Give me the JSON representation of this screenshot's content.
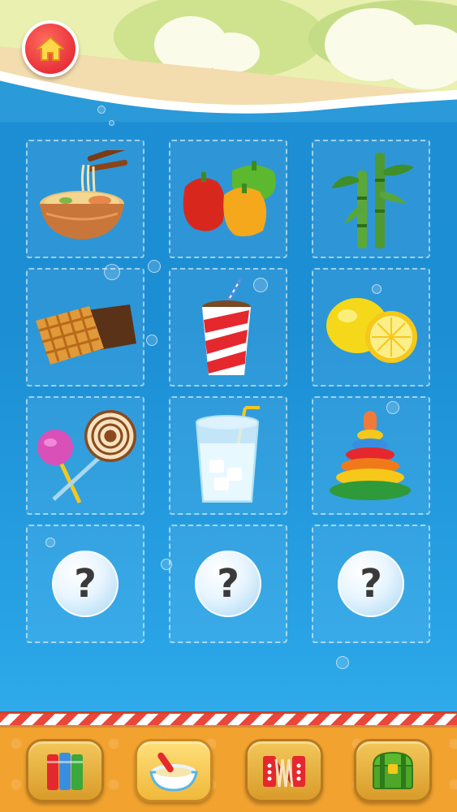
{
  "header": {
    "home_button": "home-icon"
  },
  "grid": {
    "items": [
      {
        "name": "noodle-bowl",
        "icon": "noodle-bowl-icon",
        "unlocked": true
      },
      {
        "name": "bell-peppers",
        "icon": "bell-peppers-icon",
        "unlocked": true
      },
      {
        "name": "bamboo",
        "icon": "bamboo-icon",
        "unlocked": true
      },
      {
        "name": "waffle",
        "icon": "waffle-icon",
        "unlocked": true
      },
      {
        "name": "soda-cup",
        "icon": "soda-cup-icon",
        "unlocked": true
      },
      {
        "name": "lemon",
        "icon": "lemon-icon",
        "unlocked": true
      },
      {
        "name": "lollipops",
        "icon": "lollipop-icon",
        "unlocked": true
      },
      {
        "name": "water-glass",
        "icon": "water-glass-icon",
        "unlocked": true
      },
      {
        "name": "stacking-rings",
        "icon": "ring-stack-icon",
        "unlocked": true
      },
      {
        "name": "locked",
        "icon": "question-bubble-icon",
        "unlocked": false,
        "label": "?"
      },
      {
        "name": "locked",
        "icon": "question-bubble-icon",
        "unlocked": false,
        "label": "?"
      },
      {
        "name": "locked",
        "icon": "question-bubble-icon",
        "unlocked": false,
        "label": "?"
      }
    ]
  },
  "bottom_nav": {
    "items": [
      {
        "icon": "books-icon",
        "active": false
      },
      {
        "icon": "food-bowl-icon",
        "active": true
      },
      {
        "icon": "accordion-icon",
        "active": false
      },
      {
        "icon": "treasure-chest-icon",
        "active": false
      }
    ]
  },
  "colors": {
    "water": "#1e8fd3",
    "home_red": "#e8323a",
    "bar_orange": "#f2a22e"
  }
}
